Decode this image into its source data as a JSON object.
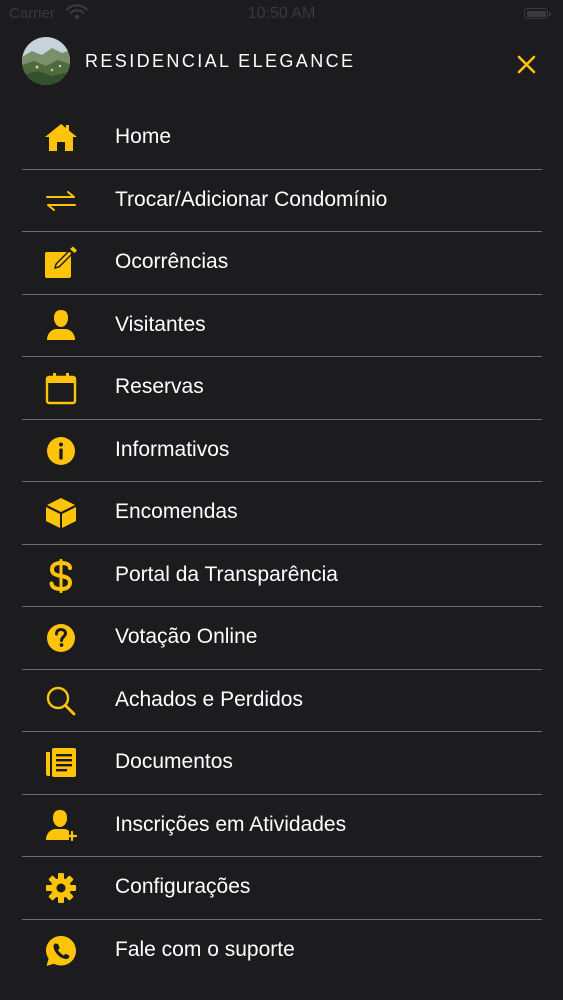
{
  "status_bar": {
    "carrier": "Carrier",
    "time": "10:50 AM",
    "wifi_icon": "wifi-icon",
    "battery_icon": "battery-icon"
  },
  "header": {
    "title": "RESIDENCIAL ELEGANCE",
    "avatar_icon": "condo-photo",
    "close_icon": "close-icon"
  },
  "colors": {
    "background": "#1c1c1e",
    "accent": "#ffc408",
    "text": "#ffffff",
    "divider": "#6e6e70"
  },
  "menu": {
    "items": [
      {
        "label": "Home",
        "icon": "home-icon"
      },
      {
        "label": "Trocar/Adicionar Condomínio",
        "icon": "swap-arrows-icon"
      },
      {
        "label": "Ocorrências",
        "icon": "edit-icon"
      },
      {
        "label": "Visitantes",
        "icon": "person-icon"
      },
      {
        "label": "Reservas",
        "icon": "calendar-icon"
      },
      {
        "label": "Informativos",
        "icon": "info-icon"
      },
      {
        "label": "Encomendas",
        "icon": "package-icon"
      },
      {
        "label": "Portal da Transparência",
        "icon": "dollar-icon"
      },
      {
        "label": "Votação Online",
        "icon": "question-icon"
      },
      {
        "label": "Achados e Perdidos",
        "icon": "search-icon"
      },
      {
        "label": "Documentos",
        "icon": "document-icon"
      },
      {
        "label": "Inscrições em Atividades",
        "icon": "person-add-icon"
      },
      {
        "label": "Configurações",
        "icon": "gear-icon"
      },
      {
        "label": "Fale com o suporte",
        "icon": "whatsapp-icon"
      }
    ]
  }
}
